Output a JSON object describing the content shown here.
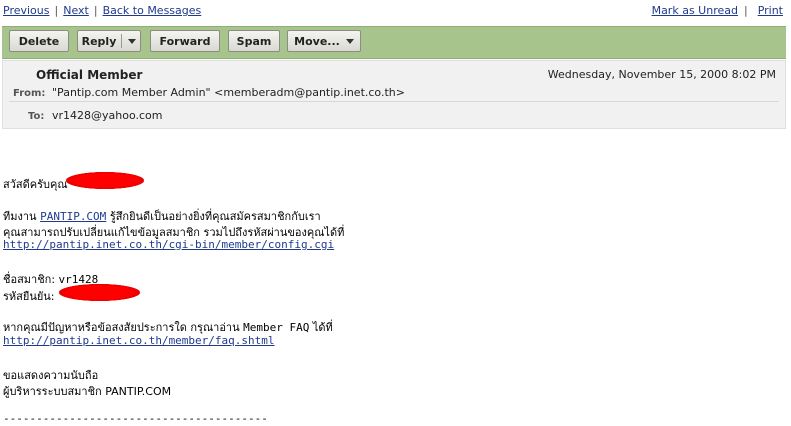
{
  "nav": {
    "previous": "Previous",
    "next": "Next",
    "back": "Back to Messages",
    "mark_unread": "Mark as Unread",
    "print": "Print",
    "separator": "|"
  },
  "toolbar": {
    "delete": "Delete",
    "reply": "Reply",
    "forward": "Forward",
    "spam": "Spam",
    "move": "Move..."
  },
  "header": {
    "title": "Official Member",
    "date": "Wednesday, November 15, 2000 8:02 PM",
    "from_label": "From:",
    "from_value": "\"Pantip.com Member Admin\" <memberadm@pantip.inet.co.th>",
    "to_label": "To:",
    "to_value": "vr1428@yahoo.com"
  },
  "message": {
    "greeting": "สวัสดีครับคุณ",
    "line1_prefix": "ทีมงาน",
    "line1_link": "PANTIP.COM",
    "line1_suffix": "รู้สึกยินดีเป็นอย่างยิ่งที่คุณสมัครสมาชิกกับเรา",
    "line2": "คุณสามารถปรับเปลี่ยนแก้ไขข้อมูลสมาชิก รวมไปถึงรหัสผ่านของคุณได้ที่",
    "config_url": "http://pantip.inet.co.th/cgi-bin/member/config.cgi",
    "username_label": "ชื่อสมาชิก:",
    "username_value": "vr1428",
    "confirm_label": "รหัสยืนยัน:",
    "faq_line_prefix": "หากคุณมีปัญหาหรือข้อสงสัยประการใด กรุณาอ่าน",
    "faq_line_mono": "Member FAQ",
    "faq_line_suffix": "ได้ที่",
    "faq_url": "http://pantip.inet.co.th/member/faq.shtml",
    "thanks": "ขอแสดงความนับถือ",
    "signature": "ผู้บริหารระบบสมาชิก PANTIP.COM",
    "rule": "----------------------------------------"
  },
  "colors": {
    "toolbar_bg": "#a6c48c",
    "link": "#1f3a8c",
    "redaction": "#ff0000"
  }
}
